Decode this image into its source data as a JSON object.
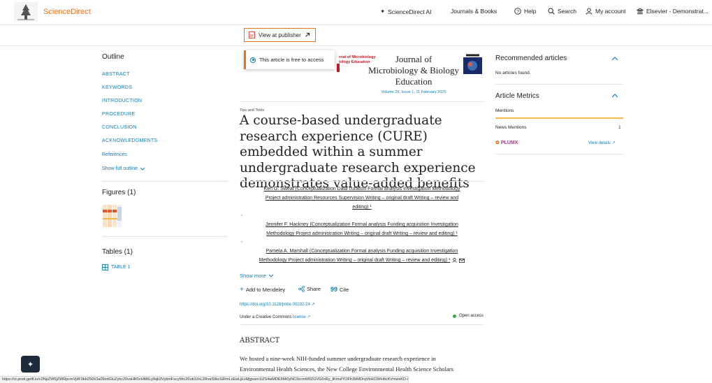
{
  "topbar": {
    "brand": "ScienceDirect",
    "nav": [
      {
        "label": "ScienceDirect AI",
        "icon": "sparkle-icon"
      },
      {
        "label": "Journals & Books",
        "icon": ""
      },
      {
        "label": "Help",
        "icon": "help-icon"
      },
      {
        "label": "Search",
        "icon": "search-icon"
      },
      {
        "label": "My account",
        "icon": "user-icon"
      },
      {
        "label": "Elsevier - Demonstrat...",
        "icon": "institution-icon"
      }
    ]
  },
  "publisher_button": "View at publisher",
  "dropdown": {
    "label": "This article is free to access"
  },
  "outline": {
    "title": "Outline",
    "items": [
      "ABSTRACT",
      "KEYWORDS",
      "INTRODUCTION",
      "PROCEDURE",
      "CONCLUSION",
      "ACKNOWLEDGMENTS",
      "References"
    ],
    "show_full": "Show full outline"
  },
  "figures": {
    "title": "Figures (1)"
  },
  "tables": {
    "title": "Tables (1)",
    "item": "TABLE 1"
  },
  "journal": {
    "cover_text_1": "rnal of Microbiology",
    "cover_text_2": "iology Education",
    "name_line1": "Journal of",
    "name_line2": "Microbiology & Biology",
    "name_line3": "Education",
    "volume": "Volume 26, Issue 1, 11 February 2025"
  },
  "article": {
    "type": "Tips and Tools",
    "title": "A course-based undergraduate research experience (CURE) embedded within a summer undergraduate research experience demonstrates value-added benefits",
    "authors": [
      {
        "line1": "Ken G. Sweat (Conceptualization Data curation Formal analysis Investigation Methodology",
        "line2": "Project administration Resources Supervision Writing – original draft Writing – review and",
        "line3": "editing) ¹"
      },
      {
        "line1": "Jennifer F. Hackney (Conceptualization Formal analysis Funding acquisition Investigation",
        "line2": "Methodology Project administration Writing – original draft Writing – review and editing) ¹"
      },
      {
        "line1": "Pamela A. Marshall (Conceptualization Formal analysis Funding acquisition Investigation",
        "line2": "Methodology Project administration Writing – original draft Writing – review and editing) ¹"
      }
    ],
    "show_more": "Show more",
    "actions": [
      "Add to Mendeley",
      "Share",
      "Cite"
    ],
    "doi": "https://doi.org/10.1128/jmbe.00192-24 ↗",
    "license_prefix": "Under a Creative Commons",
    "license_link": "license ↗",
    "open_access": "Open access",
    "abstract_heading": "ABSTRACT",
    "abstract_line1": "We hosted a nine-week NIH-funded summer undergraduate research experience in",
    "abstract_line2": "Environmental Health Sciences, the New College Environmental Health Science Scholars"
  },
  "recommended": {
    "title": "Recommended articles",
    "empty": "No articles found."
  },
  "metrics": {
    "title": "Article Metrics",
    "mentions": "Mentions",
    "news_label": "News Mentions",
    "news_count": "1",
    "plumx": "PLUMX",
    "view_details": "View details ↗"
  },
  "status_url": "https://ct.prod.getft.io/c2NpZW5jZWRpcmVjdF9kb250X3a09zdGluZyhc20vaHR0cHM6Ly9qb3VybmFscy5hc20ub3JnL2RvaS9kcGRmLzEwLjExMjgvam1iZS4wMDE5Mi0yNC9zcmM9ZGV0ZnRy_tKmulYOFfr2bMDrqVbHO3#HttcKVmwxKD-cP_eQM",
  "colors": {
    "accent": "#e9711c",
    "link": "#0c7dbb"
  }
}
